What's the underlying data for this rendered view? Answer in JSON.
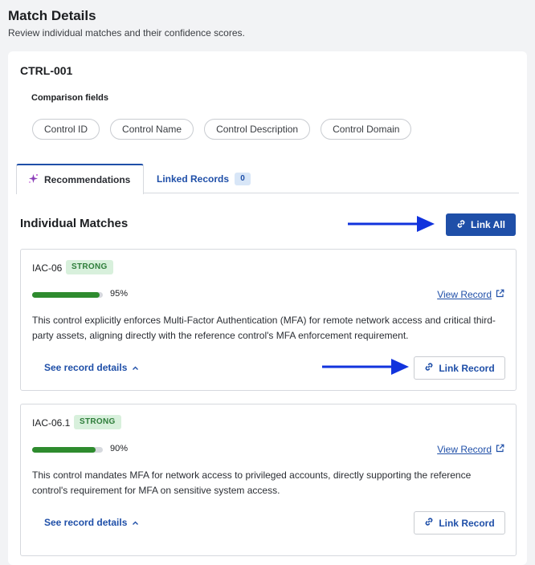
{
  "header": {
    "title": "Match Details",
    "subtitle": "Review individual matches and their confidence scores."
  },
  "control": {
    "id": "CTRL-001",
    "comparison_label": "Comparison fields",
    "fields": [
      "Control ID",
      "Control Name",
      "Control Description",
      "Control Domain"
    ]
  },
  "tabs": [
    {
      "label": "Recommendations",
      "icon": "sparkle-icon",
      "active": true
    },
    {
      "label": "Linked Records",
      "count": "0",
      "active": false
    }
  ],
  "section": {
    "title": "Individual Matches",
    "link_all_label": "Link All"
  },
  "matches": [
    {
      "id": "IAC-06",
      "strength": "STRONG",
      "confidence": 95,
      "confidence_label": "95%",
      "view_label": "View Record",
      "description": "This control explicitly enforces Multi-Factor Authentication (MFA) for remote network access and critical third-party assets, aligning directly with the reference control's MFA enforcement requirement.",
      "details_label": "See record details",
      "link_label": "Link Record"
    },
    {
      "id": "IAC-06.1",
      "strength": "STRONG",
      "confidence": 90,
      "confidence_label": "90%",
      "view_label": "View Record",
      "description": "This control mandates MFA for network access to privileged accounts, directly supporting the reference control's requirement for MFA on sensitive system access.",
      "details_label": "See record details",
      "link_label": "Link Record"
    }
  ],
  "colors": {
    "accent": "#1f4fa8",
    "strong_bg": "#d8f0dc",
    "strong_text": "#2e7d3a",
    "bar_fill": "#2e8b2e",
    "annotation_arrow": "#1133dd"
  }
}
